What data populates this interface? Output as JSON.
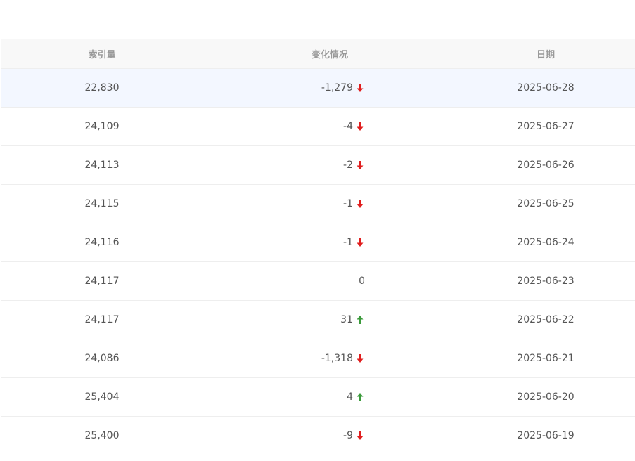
{
  "table": {
    "headers": {
      "index": "索引量",
      "change": "变化情况",
      "date": "日期"
    },
    "rows": [
      {
        "index": "22,830",
        "change": "-1,279",
        "direction": "down",
        "date": "2025-06-28"
      },
      {
        "index": "24,109",
        "change": "-4",
        "direction": "down",
        "date": "2025-06-27"
      },
      {
        "index": "24,113",
        "change": "-2",
        "direction": "down",
        "date": "2025-06-26"
      },
      {
        "index": "24,115",
        "change": "-1",
        "direction": "down",
        "date": "2025-06-25"
      },
      {
        "index": "24,116",
        "change": "-1",
        "direction": "down",
        "date": "2025-06-24"
      },
      {
        "index": "24,117",
        "change": "0",
        "direction": "none",
        "date": "2025-06-23"
      },
      {
        "index": "24,117",
        "change": "31",
        "direction": "up",
        "date": "2025-06-22"
      },
      {
        "index": "24,086",
        "change": "-1,318",
        "direction": "down",
        "date": "2025-06-21"
      },
      {
        "index": "25,404",
        "change": "4",
        "direction": "up",
        "date": "2025-06-20"
      },
      {
        "index": "25,400",
        "change": "-9",
        "direction": "down",
        "date": "2025-06-19"
      }
    ]
  },
  "colors": {
    "down": "#e01e1e",
    "up": "#3a9a3a",
    "highlight_row": "#f3f7ff",
    "header_bg": "#f8f8f8"
  },
  "icons": {
    "down": "arrow-down-icon",
    "up": "arrow-up-icon"
  }
}
